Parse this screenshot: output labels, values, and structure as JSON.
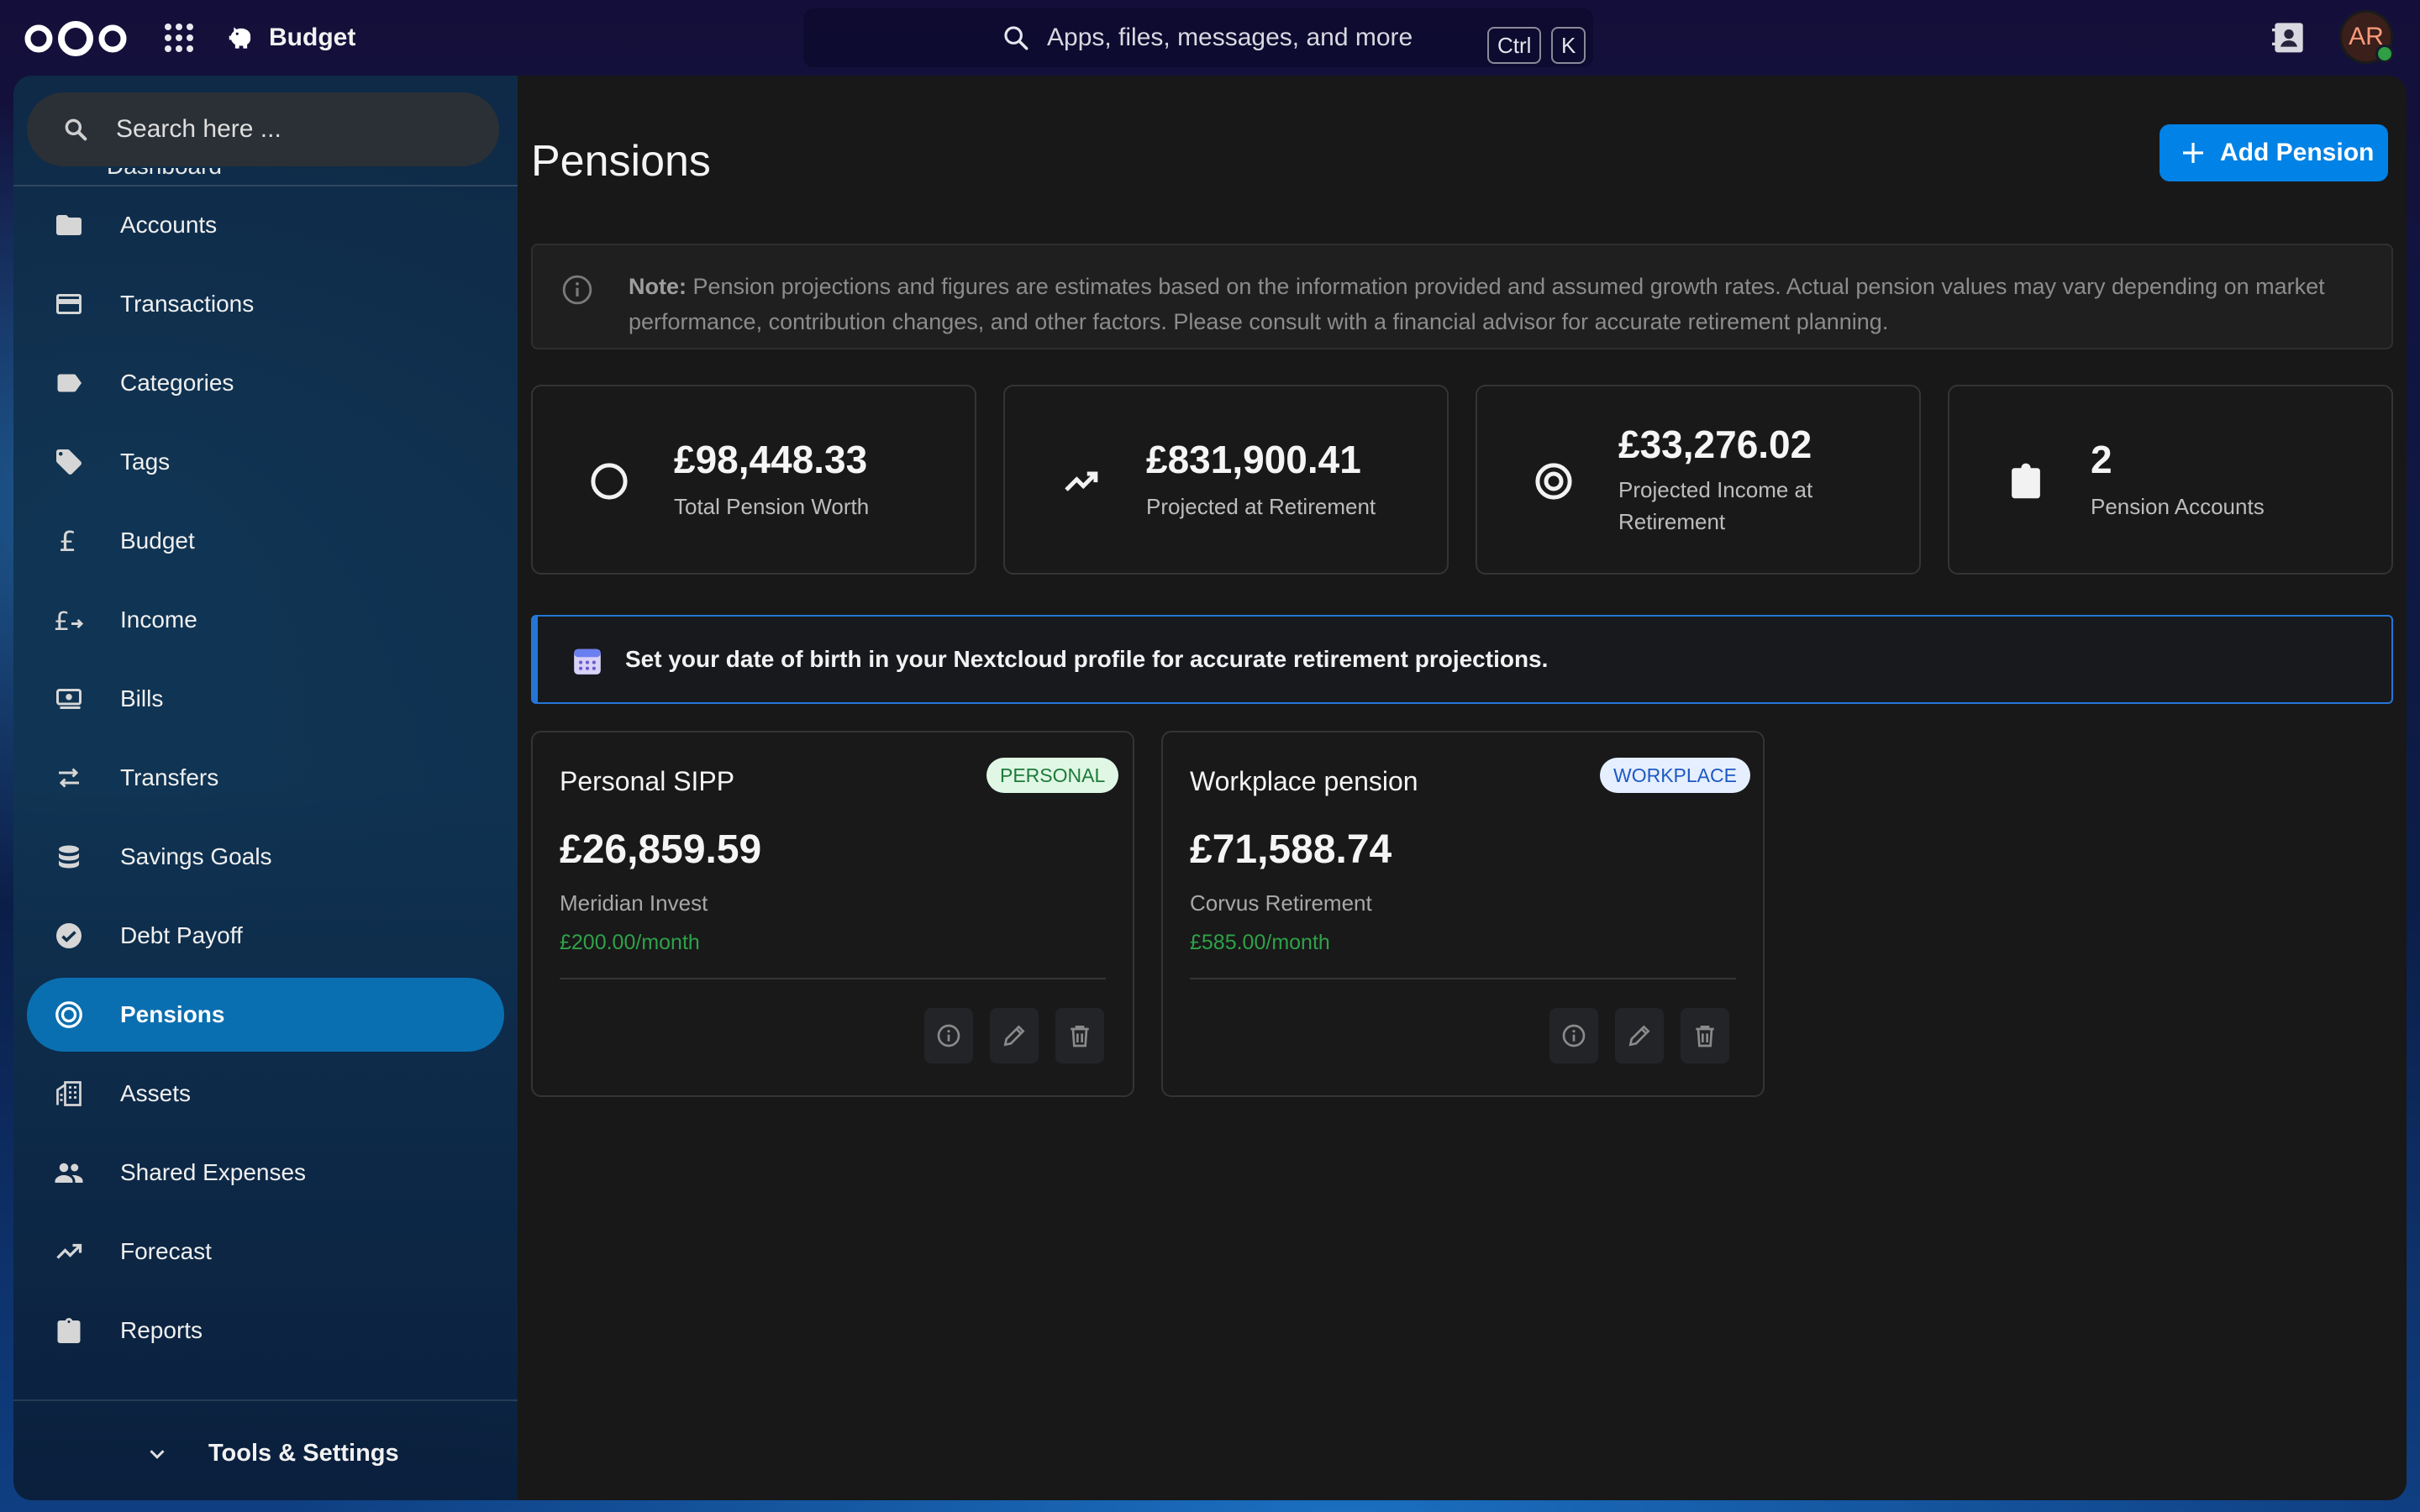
{
  "header": {
    "app_name": "Budget",
    "search_placeholder": "Apps, files, messages, and more",
    "shortcut_keys": [
      "Ctrl",
      "K"
    ],
    "avatar_initials": "AR"
  },
  "sidebar": {
    "search_placeholder": "Search here ...",
    "partial_item": "Dashboard",
    "items": [
      {
        "label": "Accounts",
        "icon": "folder-icon"
      },
      {
        "label": "Transactions",
        "icon": "credit-card-icon"
      },
      {
        "label": "Categories",
        "icon": "label-icon"
      },
      {
        "label": "Tags",
        "icon": "tag-icon"
      },
      {
        "label": "Budget",
        "icon": "pound-icon"
      },
      {
        "label": "Income",
        "icon": "pound-plus-icon"
      },
      {
        "label": "Bills",
        "icon": "cash-icon"
      },
      {
        "label": "Transfers",
        "icon": "swap-icon"
      },
      {
        "label": "Savings Goals",
        "icon": "database-icon"
      },
      {
        "label": "Debt Payoff",
        "icon": "check-circle-icon"
      },
      {
        "label": "Pensions",
        "icon": "target-icon",
        "active": true
      },
      {
        "label": "Assets",
        "icon": "buildings-icon"
      },
      {
        "label": "Shared Expenses",
        "icon": "people-icon"
      },
      {
        "label": "Forecast",
        "icon": "trending-up-icon"
      },
      {
        "label": "Reports",
        "icon": "clipboard-icon"
      }
    ],
    "footer_label": "Tools & Settings"
  },
  "main": {
    "title": "Pensions",
    "add_button": "Add Pension",
    "note_label": "Note:",
    "note_text": "Pension projections and figures are estimates based on the information provided and assumed growth rates. Actual pension values may vary depending on market performance, contribution changes, and other factors. Please consult with a financial advisor for accurate retirement planning.",
    "stats": [
      {
        "value": "£98,448.33",
        "caption": "Total Pension Worth",
        "icon": "circle-icon"
      },
      {
        "value": "£831,900.41",
        "caption": "Projected at Retirement",
        "icon": "trending-up-icon"
      },
      {
        "value": "£33,276.02",
        "caption": "Projected Income at Retirement",
        "icon": "target-icon"
      },
      {
        "value": "2",
        "caption": "Pension Accounts",
        "icon": "clipboard-icon"
      }
    ],
    "dob_notice": "Set your date of birth in your Nextcloud profile for accurate retirement projections.",
    "pensions": [
      {
        "name": "Personal SIPP",
        "badge": "PERSONAL",
        "amount": "£26,859.59",
        "provider": "Meridian Invest",
        "contribution": "£200.00/month"
      },
      {
        "name": "Workplace pension",
        "badge": "WORKPLACE",
        "amount": "£71,588.74",
        "provider": "Corvus Retirement",
        "contribution": "£585.00/month"
      }
    ]
  },
  "colors": {
    "accent": "#0082e6",
    "active_nav": "#0a6fb0",
    "success": "#2ea24a",
    "info_border": "#2476d6"
  }
}
